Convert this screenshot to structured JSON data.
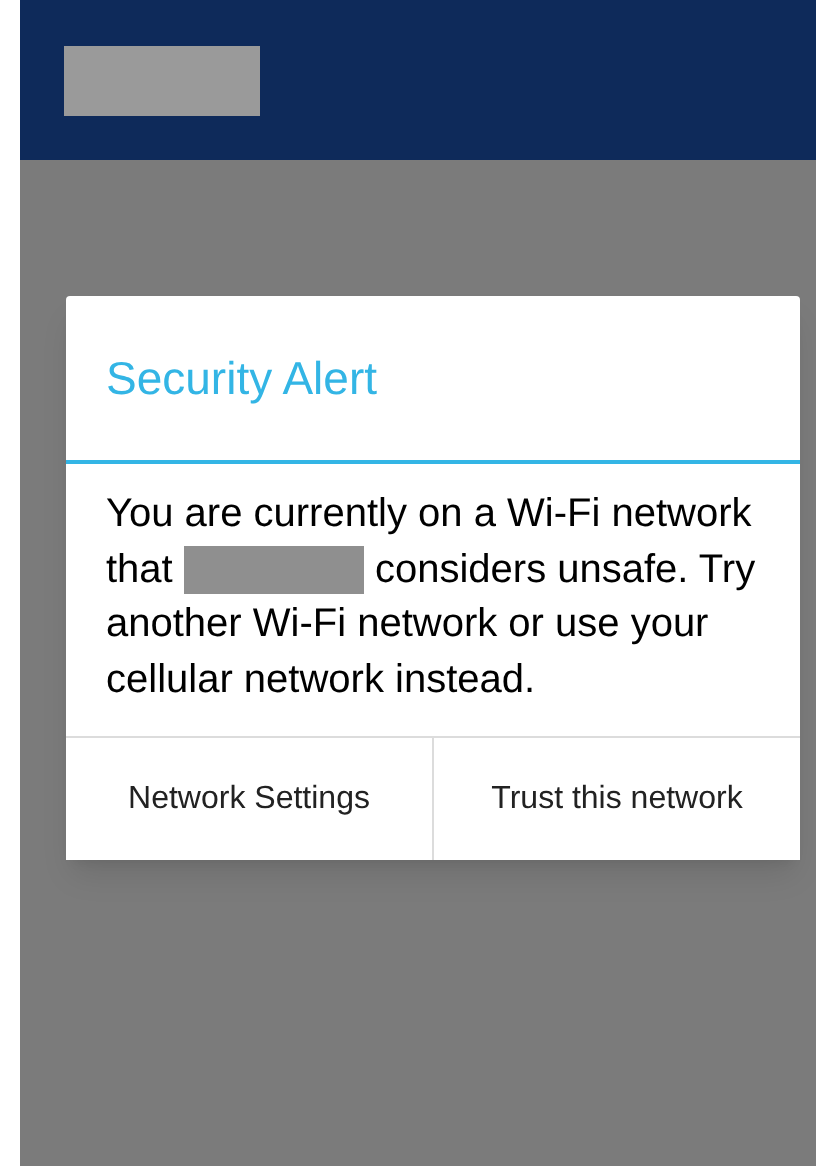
{
  "dialog": {
    "title": "Security Alert",
    "message_before": "You are currently on a Wi-Fi network that",
    "message_after": "considers unsafe. Try another Wi-Fi network or use your cellular network instead.",
    "buttons": [
      "Network Settings",
      "Trust this network"
    ]
  }
}
